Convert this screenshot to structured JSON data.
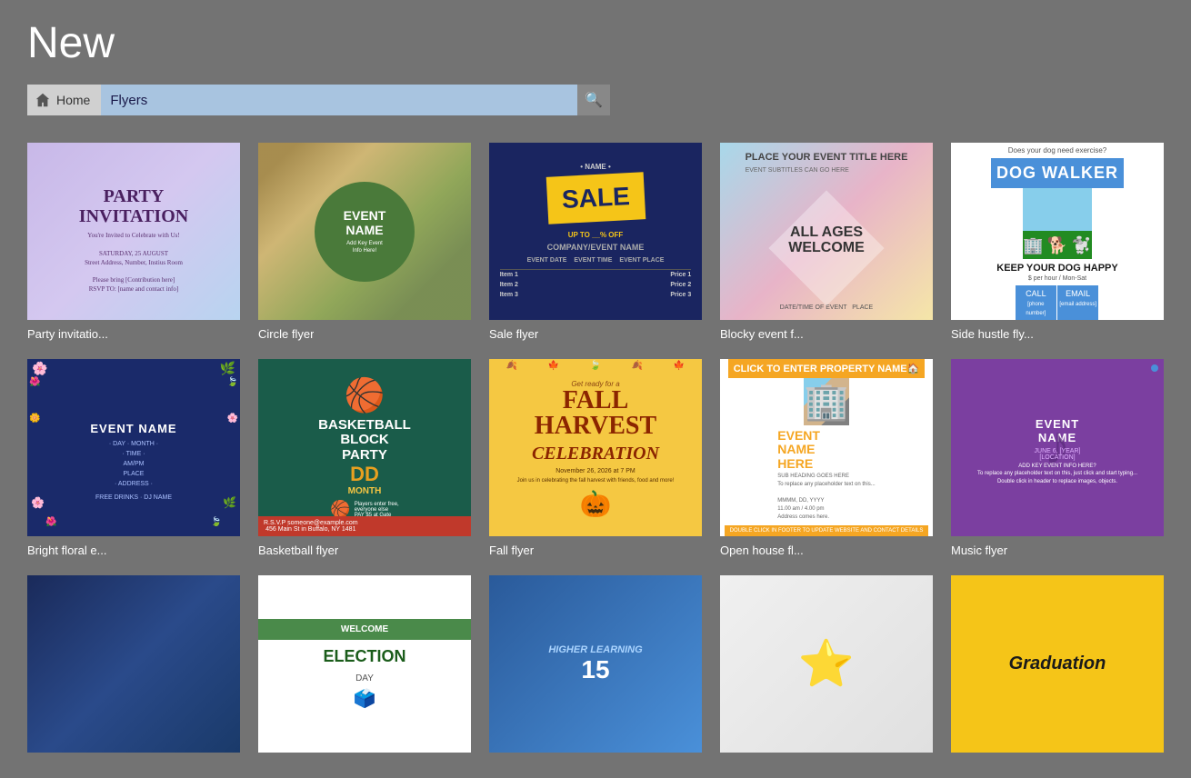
{
  "page": {
    "title": "New",
    "home_label": "Home",
    "search_value": "Flyers",
    "search_placeholder": "Flyers"
  },
  "templates": {
    "row1": [
      {
        "id": "party",
        "label": "Party invitatio..."
      },
      {
        "id": "circle",
        "label": "Circle flyer"
      },
      {
        "id": "sale",
        "label": "Sale flyer"
      },
      {
        "id": "blocky",
        "label": "Blocky event f..."
      },
      {
        "id": "dogwalker",
        "label": "Side hustle fly..."
      }
    ],
    "row2": [
      {
        "id": "floral",
        "label": "Bright floral e..."
      },
      {
        "id": "basketball",
        "label": "Basketball flyer"
      },
      {
        "id": "fall",
        "label": "Fall flyer"
      },
      {
        "id": "openhouse",
        "label": "Open house fl..."
      },
      {
        "id": "music",
        "label": "Music flyer"
      }
    ],
    "row3": [
      {
        "id": "photo",
        "label": ""
      },
      {
        "id": "election",
        "label": ""
      },
      {
        "id": "higher",
        "label": ""
      },
      {
        "id": "star",
        "label": ""
      },
      {
        "id": "graduation",
        "label": ""
      }
    ]
  },
  "thumbs": {
    "party": {
      "title": "PARTY INVITATION",
      "sub": "You're Invited to Celebrate with Us!"
    },
    "circle": {
      "title": "EVENT NAME",
      "sub": "Add Key Event Info Here!"
    },
    "sale": {
      "badge": "SALE",
      "sub": "COMPANY/EVENT NAME"
    },
    "blocky": {
      "title": "PLACE YOUR EVENT TITLE HERE",
      "mid": "ALL AGES WELCOME"
    },
    "dogwalker": {
      "title": "DOG WALKER",
      "tagline": "KEEP YOUR DOG HAPPY",
      "rate": "$ per hour / Mon-Sat",
      "cta1": "CALL",
      "cta2": "EMAIL"
    },
    "floral": {
      "title": "EVENT NAME"
    },
    "basketball": {
      "line1": "BASKETBALL",
      "line2": "BLOCK",
      "line3": "PARTY",
      "dd": "DD",
      "month": "MONTH",
      "sub": "Players enter free, everyone else PAY $5 at Gate"
    },
    "fall": {
      "pre": "Get ready for a",
      "title1": "FALL",
      "title2": "HARVEST",
      "title3": "Celebration",
      "date": "November 26, 2026 at 7 PM",
      "desc": "Join us in celebrating the fall harvest with friends, food and more!"
    },
    "openhouse": {
      "header": "CLICK TO ENTER PROPERTY NAME",
      "title1": "EVENT",
      "title2": "NAME",
      "title3": "HERE",
      "subhead": "SUB HEADING GOES HERE",
      "date": "MMMM, DD, YYYY",
      "time": "11.00 am / 4.00 pm",
      "address": "Address comes here."
    },
    "music": {
      "title1": "EVENT",
      "title2": "NAME",
      "date": "JUNE 6, [YEAR]",
      "location": "[LOCATION]"
    }
  }
}
